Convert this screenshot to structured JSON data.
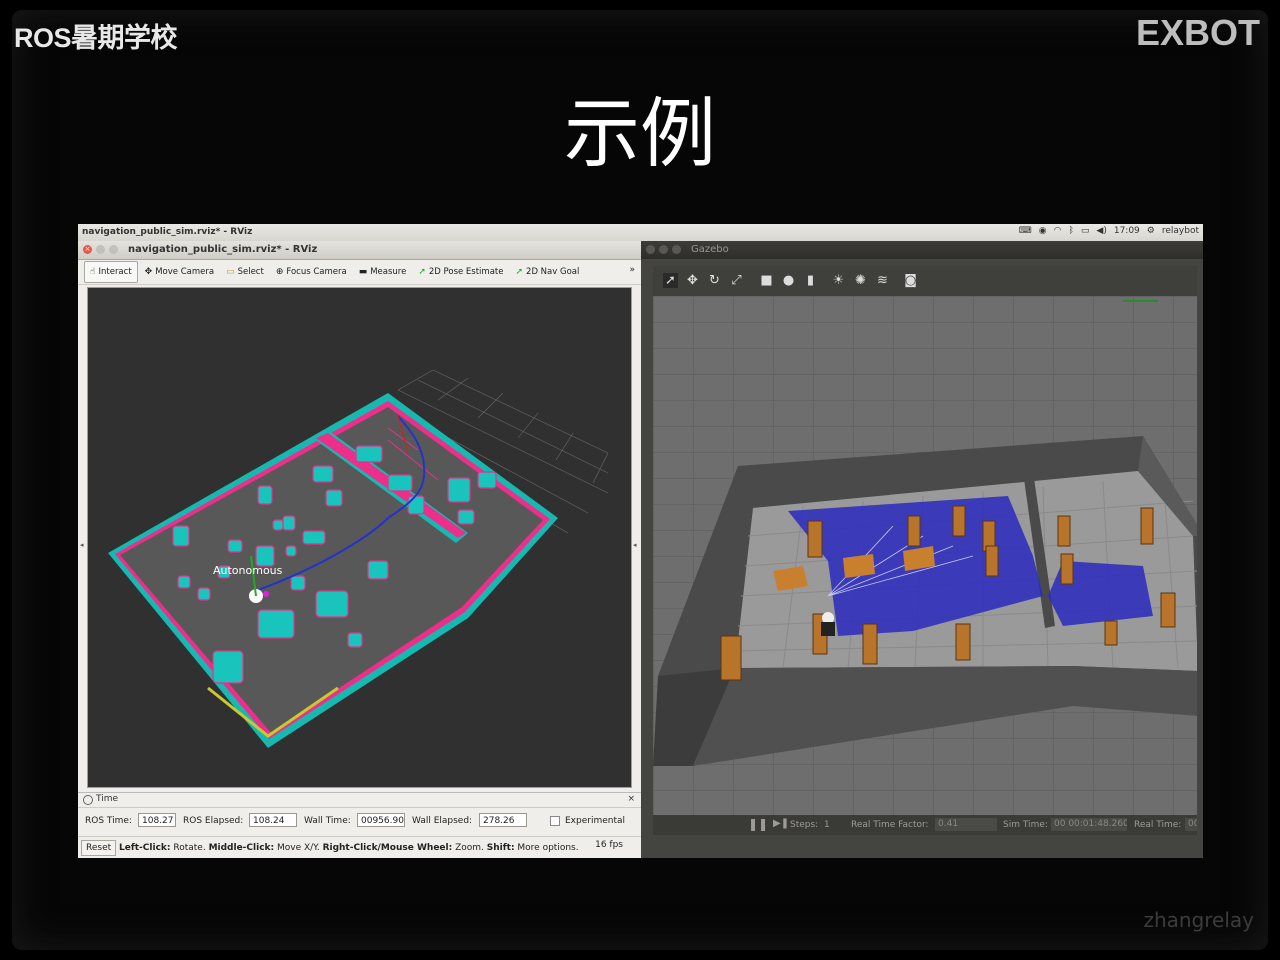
{
  "slide": {
    "brand_left": "ROS暑期学校",
    "brand_right": "EXBOT",
    "title": "示例",
    "watermark": "zhangrelay"
  },
  "desktop": {
    "active_app_title": "navigation_public_sim.rviz* - RViz",
    "clock": "17:09",
    "user": "relaybot",
    "tray_icons": [
      "keyboard-icon",
      "ubuntu-icon",
      "wifi-icon",
      "bluetooth-icon",
      "battery-icon",
      "volume-icon",
      "gear-icon"
    ]
  },
  "rviz": {
    "window_title": "navigation_public_sim.rviz* - RViz",
    "tools": [
      {
        "label": "Interact",
        "icon": "hand-icon"
      },
      {
        "label": "Move Camera",
        "icon": "move-camera-icon"
      },
      {
        "label": "Select",
        "icon": "select-icon"
      },
      {
        "label": "Focus Camera",
        "icon": "focus-icon"
      },
      {
        "label": "Measure",
        "icon": "ruler-icon"
      },
      {
        "label": "2D Pose Estimate",
        "icon": "arrow-icon"
      },
      {
        "label": "2D Nav Goal",
        "icon": "arrow-icon"
      }
    ],
    "more_tools": "»",
    "robot_label": "Autonomous",
    "time_panel": {
      "title": "Time",
      "ros_time_label": "ROS Time:",
      "ros_time": "108.27",
      "ros_elapsed_label": "ROS Elapsed:",
      "ros_elapsed": "108.24",
      "wall_time_label": "Wall Time:",
      "wall_time": "00956.90",
      "wall_elapsed_label": "Wall Elapsed:",
      "wall_elapsed": "278.26",
      "experimental_label": "Experimental"
    },
    "status": {
      "reset": "Reset",
      "left_click": "Left-Click:",
      "left_desc": " Rotate. ",
      "middle_click": "Middle-Click:",
      "middle_desc": " Move X/Y. ",
      "right_click": "Right-Click/Mouse Wheel:",
      "right_desc": " Zoom. ",
      "shift": "Shift:",
      "shift_desc": " More options.",
      "fps": "16 fps"
    }
  },
  "gazebo": {
    "window_title": "Gazebo",
    "steps_label": "Steps:",
    "steps_value": "1",
    "rtf_label": "Real Time Factor:",
    "rtf_value": "0.41",
    "sim_time_label": "Sim Time:",
    "sim_time": "00 00:01:48.260",
    "real_time_label": "Real Time:",
    "real_time": "00"
  }
}
